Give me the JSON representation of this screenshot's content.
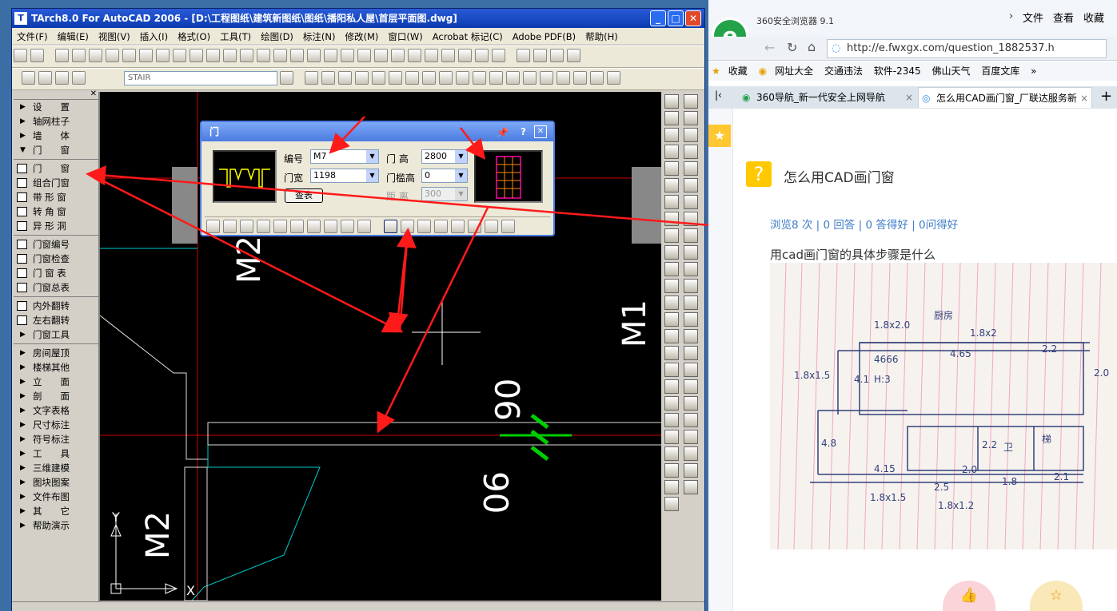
{
  "cad": {
    "title": "TArch8.0 For AutoCAD 2006 - [D:\\工程图纸\\建筑新图纸\\图纸\\播阳私人屋\\首层平面图.dwg]",
    "menu": [
      "文件(F)",
      "编辑(E)",
      "视图(V)",
      "插入(I)",
      "格式(O)",
      "工具(T)",
      "绘图(D)",
      "标注(N)",
      "修改(M)",
      "窗口(W)",
      "Acrobat 标记(C)",
      "Adobe PDF(B)",
      "帮助(H)"
    ],
    "layer": "STAIR",
    "sidebar": {
      "top": [
        "设　　置",
        "轴网柱子",
        "墙　　体",
        "门　　窗"
      ],
      "door_tools": [
        "门　　窗",
        "组合门窗",
        "带 形 窗",
        "转 角 窗",
        "异 形 洞"
      ],
      "edit_tools": [
        "门窗编号",
        "门窗检查",
        "门 窗 表",
        "门窗总表"
      ],
      "flip_tools": [
        "内外翻转",
        "左右翻转",
        "门窗工具"
      ],
      "more": [
        "房间屋顶",
        "楼梯其他",
        "立　　面",
        "剖　　面",
        "文字表格",
        "尺寸标注",
        "符号标注",
        "工　　具",
        "三维建模",
        "图块图案",
        "文件布图",
        "其　　它",
        "帮助演示"
      ]
    },
    "canvas": {
      "labels": [
        "M2",
        "M1",
        "M2",
        "90",
        "90",
        "Y",
        "X"
      ]
    }
  },
  "dialog": {
    "title": "门",
    "code_label": "编号",
    "code_value": "M7",
    "width_label": "门宽",
    "width_value": "1198",
    "height_label": "门 高",
    "height_value": "2800",
    "sill_label": "门槛高",
    "sill_value": "0",
    "dist_label": "距 离",
    "dist_value": "300",
    "lookup_button": "查表",
    "help_glyph": "?",
    "close_glyph": "✕"
  },
  "browser": {
    "app": "360安全浏览器 9.1",
    "menu": [
      "文件",
      "查看",
      "收藏"
    ],
    "url": "http://e.fwxgx.com/question_1882537.h",
    "bookmarks": [
      "收藏",
      "网址大全",
      "交通违法",
      "软件-2345",
      "佛山天气",
      "百度文库"
    ],
    "tabs": [
      "360导航_新一代安全上网导航",
      "怎么用CAD画门窗_厂联达服务新"
    ],
    "question": {
      "title": "怎么用CAD画门窗",
      "stats": "浏览8 次 | 0 回答 | 0 答得好 | 0问得好",
      "body": "用cad画门窗的具体步骤是什么"
    },
    "sketch_labels": [
      "1.8x2.0",
      "4666",
      "4.65",
      "1.8x2",
      "2.2",
      "2.0",
      "4.1",
      "H:3",
      "1.8x1.5",
      "4.8",
      "4.15",
      "2.5",
      "2.0",
      "1.8",
      "2.1",
      "1.8x1.2",
      "1.8x1.5",
      "2.2",
      "卫",
      "梯",
      "厨房"
    ]
  },
  "colors": {
    "canvas": "#000000",
    "title_blue": "#0a3bb0",
    "arrow_red": "#ff1a1a",
    "link_blue": "#3d7cc9"
  }
}
